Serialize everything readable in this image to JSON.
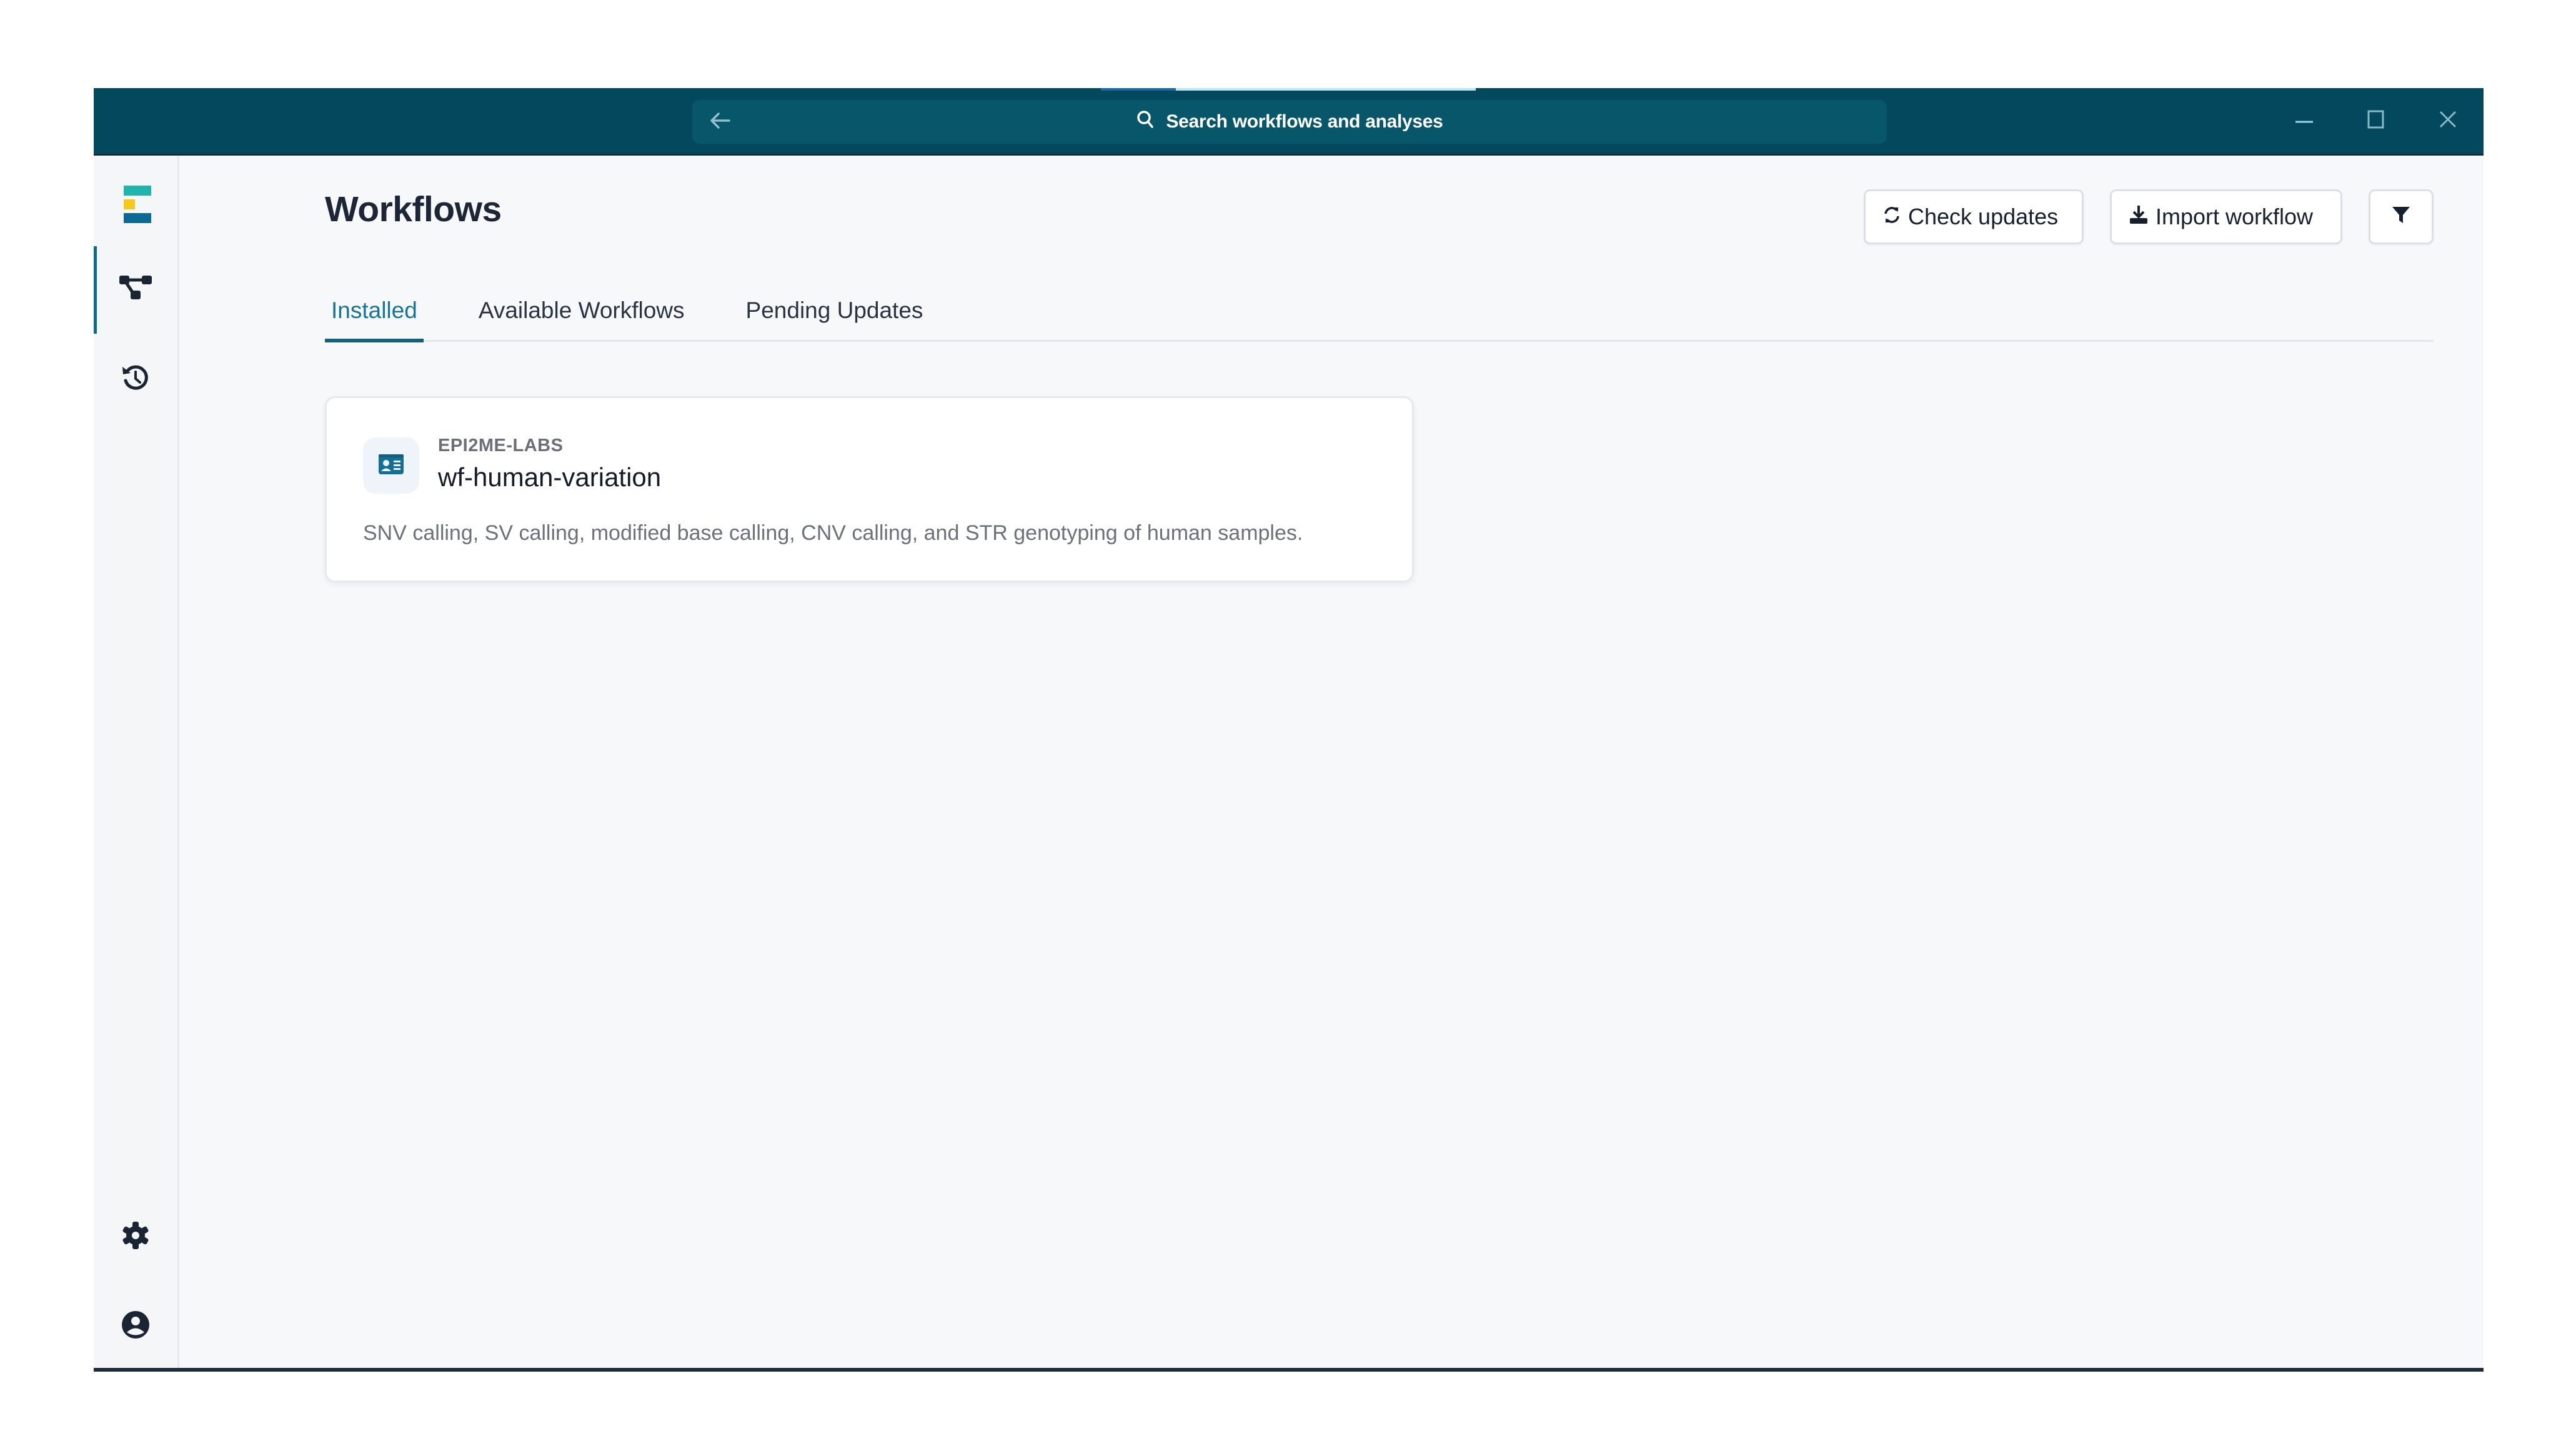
{
  "titlebar": {
    "search_placeholder": "Search workflows and analyses",
    "loading_progress": 0.2,
    "icons": {
      "back": "arrow-left-icon",
      "search": "search-icon",
      "minimize": "minimize-icon",
      "maximize": "maximize-icon",
      "close": "close-icon"
    }
  },
  "sidebar": {
    "logo": "epi2me-logo",
    "items": [
      {
        "name": "workflows",
        "icon": "workflow-icon",
        "active": true
      },
      {
        "name": "history",
        "icon": "history-icon",
        "active": false
      }
    ],
    "bottom_items": [
      {
        "name": "settings",
        "icon": "gear-icon"
      },
      {
        "name": "account",
        "icon": "user-circle-icon"
      }
    ]
  },
  "main": {
    "title": "Workflows",
    "actions": {
      "check_updates": "Check updates",
      "import_workflow": "Import workflow",
      "filter": "filter-icon"
    },
    "tabs": [
      {
        "label": "Installed",
        "active": true
      },
      {
        "label": "Available Workflows",
        "active": false
      },
      {
        "label": "Pending Updates",
        "active": false
      }
    ],
    "workflows": [
      {
        "organization": "EPI2ME-LABS",
        "name": "wf-human-variation",
        "description": "SNV calling, SV calling, modified base calling, CNV calling, and STR genotyping of human samples.",
        "icon": "id-card-icon"
      }
    ]
  },
  "colors": {
    "titlebar": "#03485c",
    "search_bg": "#07566a",
    "accent": "#17749a",
    "logo_teal": "#1fb5ac",
    "logo_yellow": "#f6c817",
    "logo_blue": "#0b6a94"
  }
}
